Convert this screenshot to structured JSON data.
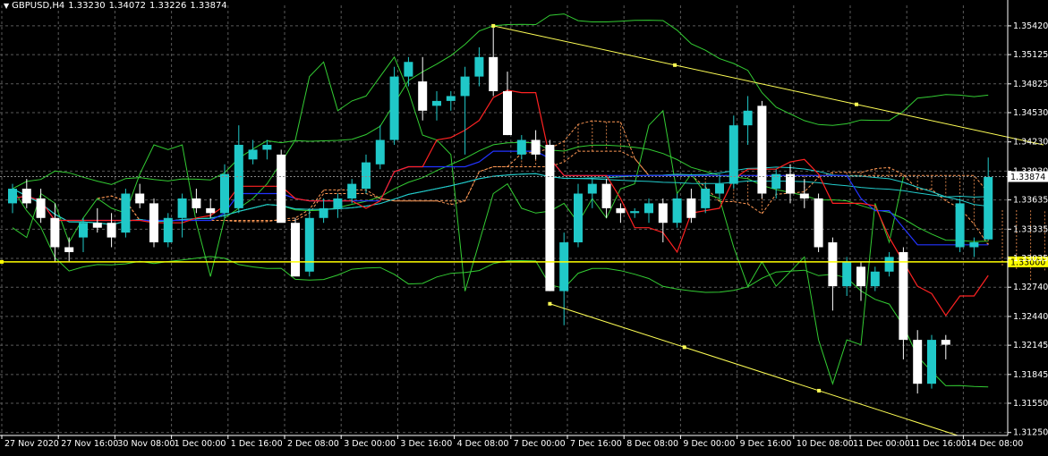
{
  "header": {
    "symbol": "GBPUSD,H4",
    "open": "1.33230",
    "high": "1.34072",
    "low": "1.33226",
    "close": "1.33874"
  },
  "colors": {
    "background": "#000000",
    "grid": "#5a5a5a",
    "bull": "#20c8c8",
    "bear": "#ffffff",
    "yellow": "#ffff55",
    "horizontal_line": "#ffff00",
    "green": "#33cc33",
    "blue": "#2233ff",
    "red": "#ff2222",
    "cyan": "#22cccc",
    "cloud": "#ff9955",
    "price_marker": "#ffff00"
  },
  "chart_data": {
    "type": "candlestick",
    "ylim": [
      1.3122,
      1.3563
    ],
    "y_ticks": [
      "1.35420",
      "1.35125",
      "1.34825",
      "1.34530",
      "1.34230",
      "1.33930",
      "1.33635",
      "1.33335",
      "1.33035",
      "1.32740",
      "1.32440",
      "1.32145",
      "1.31845",
      "1.31550",
      "1.31250"
    ],
    "x_ticks": [
      "27 Nov 2020",
      "27 Nov 16:00",
      "30 Nov 08:00",
      "1 Dec 00:00",
      "1 Dec 16:00",
      "2 Dec 08:00",
      "3 Dec 00:00",
      "3 Dec 16:00",
      "4 Dec 08:00",
      "7 Dec 00:00",
      "7 Dec 16:00",
      "8 Dec 08:00",
      "9 Dec 00:00",
      "9 Dec 16:00",
      "10 Dec 08:00",
      "11 Dec 00:00",
      "11 Dec 16:00",
      "14 Dec 08:00"
    ],
    "candles": [
      [
        1.336,
        1.338,
        1.335,
        1.3375
      ],
      [
        1.3375,
        1.3385,
        1.3355,
        1.336
      ],
      [
        1.3365,
        1.3375,
        1.334,
        1.3345
      ],
      [
        1.3345,
        1.336,
        1.33,
        1.3315
      ],
      [
        1.3315,
        1.3325,
        1.33,
        1.331
      ],
      [
        1.3325,
        1.3345,
        1.331,
        1.334
      ],
      [
        1.334,
        1.3355,
        1.333,
        1.3335
      ],
      [
        1.334,
        1.335,
        1.3315,
        1.3325
      ],
      [
        1.333,
        1.3375,
        1.3325,
        1.337
      ],
      [
        1.337,
        1.338,
        1.3355,
        1.336
      ],
      [
        1.336,
        1.3365,
        1.3315,
        1.332
      ],
      [
        1.332,
        1.335,
        1.3315,
        1.3345
      ],
      [
        1.3345,
        1.337,
        1.3325,
        1.3365
      ],
      [
        1.3365,
        1.3375,
        1.335,
        1.3355
      ],
      [
        1.3355,
        1.3365,
        1.3345,
        1.335
      ],
      [
        1.335,
        1.34,
        1.3345,
        1.339
      ],
      [
        1.3355,
        1.344,
        1.335,
        1.342
      ],
      [
        1.3405,
        1.3425,
        1.34,
        1.3415
      ],
      [
        1.3415,
        1.3425,
        1.3405,
        1.342
      ],
      [
        1.341,
        1.3415,
        1.3345,
        1.334
      ],
      [
        1.334,
        1.3345,
        1.329,
        1.3285
      ],
      [
        1.329,
        1.3355,
        1.3285,
        1.3345
      ],
      [
        1.3345,
        1.3365,
        1.334,
        1.3355
      ],
      [
        1.3355,
        1.337,
        1.3345,
        1.3365
      ],
      [
        1.3365,
        1.3385,
        1.336,
        1.338
      ],
      [
        1.3375,
        1.341,
        1.337,
        1.3402
      ],
      [
        1.34,
        1.344,
        1.3395,
        1.3425
      ],
      [
        1.3425,
        1.35,
        1.342,
        1.349
      ],
      [
        1.349,
        1.351,
        1.348,
        1.3505
      ],
      [
        1.3485,
        1.351,
        1.3445,
        1.3455
      ],
      [
        1.346,
        1.3475,
        1.3445,
        1.3465
      ],
      [
        1.3465,
        1.3475,
        1.3455,
        1.347
      ],
      [
        1.347,
        1.35,
        1.341,
        1.349
      ],
      [
        1.349,
        1.352,
        1.348,
        1.351
      ],
      [
        1.351,
        1.3542,
        1.347,
        1.3475
      ],
      [
        1.3475,
        1.3495,
        1.343,
        1.343
      ],
      [
        1.341,
        1.343,
        1.3405,
        1.3425
      ],
      [
        1.3425,
        1.3435,
        1.3405,
        1.341
      ],
      [
        1.342,
        1.3425,
        1.327,
        1.327
      ],
      [
        1.327,
        1.333,
        1.3235,
        1.332
      ],
      [
        1.332,
        1.338,
        1.3315,
        1.337
      ],
      [
        1.337,
        1.3385,
        1.3355,
        1.338
      ],
      [
        1.338,
        1.3385,
        1.3345,
        1.3355
      ],
      [
        1.3355,
        1.336,
        1.334,
        1.335
      ],
      [
        1.335,
        1.3355,
        1.3345,
        1.3352
      ],
      [
        1.335,
        1.3365,
        1.334,
        1.336
      ],
      [
        1.336,
        1.3365,
        1.332,
        1.334
      ],
      [
        1.334,
        1.337,
        1.3335,
        1.3365
      ],
      [
        1.3365,
        1.3375,
        1.334,
        1.3345
      ],
      [
        1.3355,
        1.338,
        1.335,
        1.3375
      ],
      [
        1.337,
        1.339,
        1.3365,
        1.338
      ],
      [
        1.338,
        1.345,
        1.3375,
        1.344
      ],
      [
        1.344,
        1.347,
        1.342,
        1.3455
      ],
      [
        1.346,
        1.3465,
        1.3365,
        1.337
      ],
      [
        1.3375,
        1.3395,
        1.3365,
        1.339
      ],
      [
        1.339,
        1.34,
        1.336,
        1.337
      ],
      [
        1.337,
        1.3385,
        1.3355,
        1.3365
      ],
      [
        1.3365,
        1.337,
        1.331,
        1.3315
      ],
      [
        1.332,
        1.3325,
        1.325,
        1.3275
      ],
      [
        1.3275,
        1.3305,
        1.3265,
        1.33
      ],
      [
        1.3295,
        1.33,
        1.326,
        1.3275
      ],
      [
        1.3275,
        1.3295,
        1.327,
        1.329
      ],
      [
        1.329,
        1.331,
        1.3285,
        1.3305
      ],
      [
        1.331,
        1.3315,
        1.32,
        1.322
      ],
      [
        1.322,
        1.323,
        1.3165,
        1.3175
      ],
      [
        1.3175,
        1.3225,
        1.317,
        1.322
      ],
      [
        1.322,
        1.3225,
        1.32,
        1.3215
      ],
      [
        1.3315,
        1.3365,
        1.331,
        1.336
      ],
      [
        1.3315,
        1.3325,
        1.3305,
        1.332
      ],
      [
        1.3323,
        1.3407,
        1.3323,
        1.3387
      ]
    ],
    "horizontal_line": {
      "value": 1.33,
      "label": "1.33000"
    },
    "current_price": {
      "value": 1.33874,
      "label": "1.33874"
    }
  }
}
